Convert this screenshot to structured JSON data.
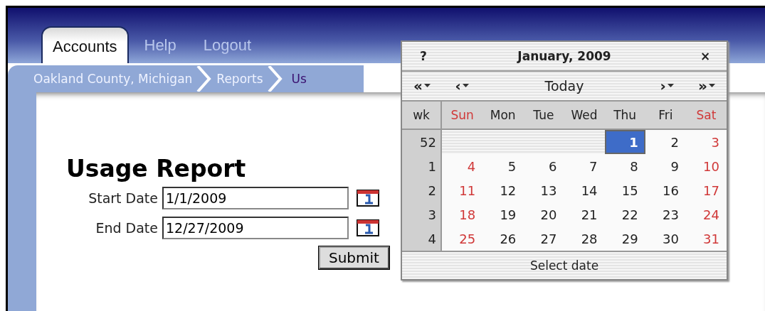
{
  "tabs": [
    {
      "label": "Accounts",
      "selected": true
    },
    {
      "label": "Help",
      "selected": false
    },
    {
      "label": "Logout",
      "selected": false
    }
  ],
  "breadcrumb": [
    {
      "label": "Oakland County, Michigan",
      "current": false
    },
    {
      "label": "Reports",
      "current": false
    },
    {
      "label": "Us",
      "current": true
    }
  ],
  "report": {
    "title": "Usage Report",
    "fields": [
      {
        "label": "Start Date",
        "value": "1/1/2009"
      },
      {
        "label": "End Date",
        "value": "12/27/2009"
      }
    ],
    "submit": "Submit"
  },
  "calendar": {
    "help": "?",
    "title": "January, 2009",
    "close": "×",
    "nav": [
      {
        "label": "«",
        "kind": "step"
      },
      {
        "label": "‹",
        "kind": "step"
      },
      {
        "label": "Today",
        "kind": "today"
      },
      {
        "label": "›",
        "kind": "step"
      },
      {
        "label": "»",
        "kind": "step"
      }
    ],
    "week_heading": "wk",
    "day_names": [
      {
        "label": "Sun",
        "weekend": true
      },
      {
        "label": "Mon",
        "weekend": false
      },
      {
        "label": "Tue",
        "weekend": false
      },
      {
        "label": "Wed",
        "weekend": false
      },
      {
        "label": "Thu",
        "weekend": false
      },
      {
        "label": "Fri",
        "weekend": false
      },
      {
        "label": "Sat",
        "weekend": true
      }
    ],
    "weeks": [
      {
        "number": "52",
        "days": [
          {
            "kind": "blank"
          },
          {
            "kind": "blank"
          },
          {
            "kind": "blank"
          },
          {
            "kind": "blank"
          },
          {
            "kind": "day",
            "text": "1",
            "weekend": false,
            "selected": true
          },
          {
            "kind": "day",
            "text": "2",
            "weekend": false,
            "selected": false
          },
          {
            "kind": "day",
            "text": "3",
            "weekend": true,
            "selected": false
          }
        ]
      },
      {
        "number": "1",
        "days": [
          {
            "kind": "day",
            "text": "4",
            "weekend": true,
            "selected": false
          },
          {
            "kind": "day",
            "text": "5",
            "weekend": false,
            "selected": false
          },
          {
            "kind": "day",
            "text": "6",
            "weekend": false,
            "selected": false
          },
          {
            "kind": "day",
            "text": "7",
            "weekend": false,
            "selected": false
          },
          {
            "kind": "day",
            "text": "8",
            "weekend": false,
            "selected": false
          },
          {
            "kind": "day",
            "text": "9",
            "weekend": false,
            "selected": false
          },
          {
            "kind": "day",
            "text": "10",
            "weekend": true,
            "selected": false
          }
        ]
      },
      {
        "number": "2",
        "days": [
          {
            "kind": "day",
            "text": "11",
            "weekend": true,
            "selected": false
          },
          {
            "kind": "day",
            "text": "12",
            "weekend": false,
            "selected": false
          },
          {
            "kind": "day",
            "text": "13",
            "weekend": false,
            "selected": false
          },
          {
            "kind": "day",
            "text": "14",
            "weekend": false,
            "selected": false
          },
          {
            "kind": "day",
            "text": "15",
            "weekend": false,
            "selected": false
          },
          {
            "kind": "day",
            "text": "16",
            "weekend": false,
            "selected": false
          },
          {
            "kind": "day",
            "text": "17",
            "weekend": true,
            "selected": false
          }
        ]
      },
      {
        "number": "3",
        "days": [
          {
            "kind": "day",
            "text": "18",
            "weekend": true,
            "selected": false
          },
          {
            "kind": "day",
            "text": "19",
            "weekend": false,
            "selected": false
          },
          {
            "kind": "day",
            "text": "20",
            "weekend": false,
            "selected": false
          },
          {
            "kind": "day",
            "text": "21",
            "weekend": false,
            "selected": false
          },
          {
            "kind": "day",
            "text": "22",
            "weekend": false,
            "selected": false
          },
          {
            "kind": "day",
            "text": "23",
            "weekend": false,
            "selected": false
          },
          {
            "kind": "day",
            "text": "24",
            "weekend": true,
            "selected": false
          }
        ]
      },
      {
        "number": "4",
        "days": [
          {
            "kind": "day",
            "text": "25",
            "weekend": true,
            "selected": false
          },
          {
            "kind": "day",
            "text": "26",
            "weekend": false,
            "selected": false
          },
          {
            "kind": "day",
            "text": "27",
            "weekend": false,
            "selected": false
          },
          {
            "kind": "day",
            "text": "28",
            "weekend": false,
            "selected": false
          },
          {
            "kind": "day",
            "text": "29",
            "weekend": false,
            "selected": false
          },
          {
            "kind": "day",
            "text": "30",
            "weekend": false,
            "selected": false
          },
          {
            "kind": "day",
            "text": "31",
            "weekend": true,
            "selected": false
          }
        ]
      }
    ],
    "footer": "Select date"
  }
}
